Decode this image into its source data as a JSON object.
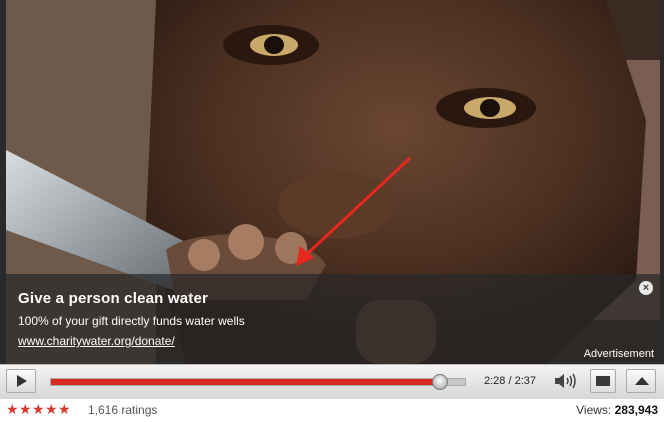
{
  "ad": {
    "title": "Give a person clean water",
    "description": "100% of your gift directly funds water wells",
    "link": "www.charitywater.org/donate/",
    "close_glyph": "×",
    "label": "Advertisement"
  },
  "player": {
    "time": "2:28 / 2:37",
    "progress": 0.94,
    "icons": {
      "play": "play-icon",
      "volume": "volume-icon",
      "size": "screen-size-icon",
      "fullscreen": "fullscreen-icon"
    }
  },
  "meta": {
    "star_count": 5,
    "stars": [
      "★",
      "★",
      "★",
      "★",
      "★"
    ],
    "ratings": "1,616 ratings",
    "views_label": "Views:",
    "views_count": "283,943"
  },
  "colors": {
    "progress": "#d62a1f",
    "stars": "#d93a2f",
    "arrow": "#e8281e"
  }
}
